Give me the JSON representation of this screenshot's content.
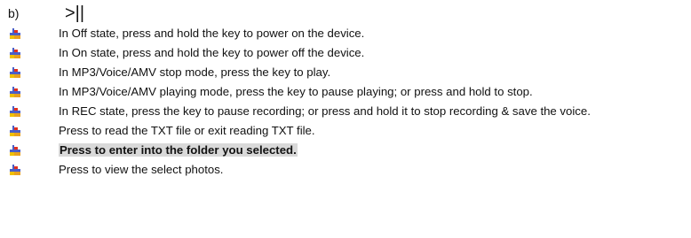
{
  "heading": {
    "label": "b)",
    "key_symbol": ">||"
  },
  "bullet_icon": "colored-bullet-icon",
  "colors": {
    "icon_blue": "#4a5ec8",
    "icon_red": "#e03020",
    "icon_yellow": "#f0c000",
    "highlight": "#d9d9d9"
  },
  "items": [
    "In Off state, press and hold the key to power on the device.",
    "In On state, press and hold the key to power off the device.",
    "In MP3/Voice/AMV stop mode, press the key to play.",
    "In MP3/Voice/AMV playing mode, press the key to pause playing; or press and hold to stop.",
    "In REC state, press the key to pause recording; or press and hold it to stop recording & save the voice.",
    "Press to read the TXT file or exit reading TXT file.",
    "Press to enter into the folder you selected.",
    "Press to view the select photos."
  ]
}
